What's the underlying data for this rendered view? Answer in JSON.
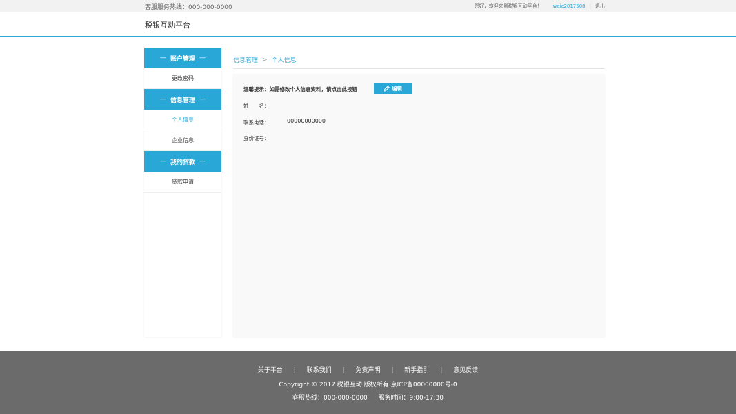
{
  "topbar": {
    "hotline": "客服服务热线：000-000-0000",
    "welcome": "您好，欢迎来到税银互动平台！",
    "username": "weic2017508",
    "logout": "退出"
  },
  "header": {
    "logo": "税银互动平台"
  },
  "sidebar": {
    "groups": [
      {
        "title": "账户管理",
        "items": [
          "更改密码"
        ]
      },
      {
        "title": "信息管理",
        "items": [
          "个人信息",
          "企业信息"
        ]
      },
      {
        "title": "我的贷款",
        "items": [
          "贷款申请"
        ]
      }
    ],
    "active_item": "个人信息",
    "dash": "—"
  },
  "breadcrumb": {
    "parent": "信息管理",
    "arrow": ">",
    "current": "个人信息"
  },
  "panel": {
    "tip": "温馨提示：如需修改个人信息资料，请点击此按钮",
    "edit_label": "编辑",
    "fields": [
      {
        "label": "姓　　名：",
        "value": ""
      },
      {
        "label": "联系电话：",
        "value": "00000000000"
      },
      {
        "label": "身份证号：",
        "value": ""
      }
    ]
  },
  "footer": {
    "links": [
      "关于平台",
      "联系我们",
      "免责声明",
      "新手指引",
      "意见反馈"
    ],
    "separator": "|",
    "copyright": "Copyright © 2017 税银互动 版权所有 京ICP备00000000号-0",
    "hotline": "客服热线：000-000-0000",
    "service_time": "服务时间：9:00-17:30"
  },
  "colors": {
    "accent": "#29a7d6",
    "footer_bg": "#6b6b6b",
    "topbar_bg": "#f2f2f2"
  },
  "icons": {
    "edit": "pencil-icon"
  }
}
